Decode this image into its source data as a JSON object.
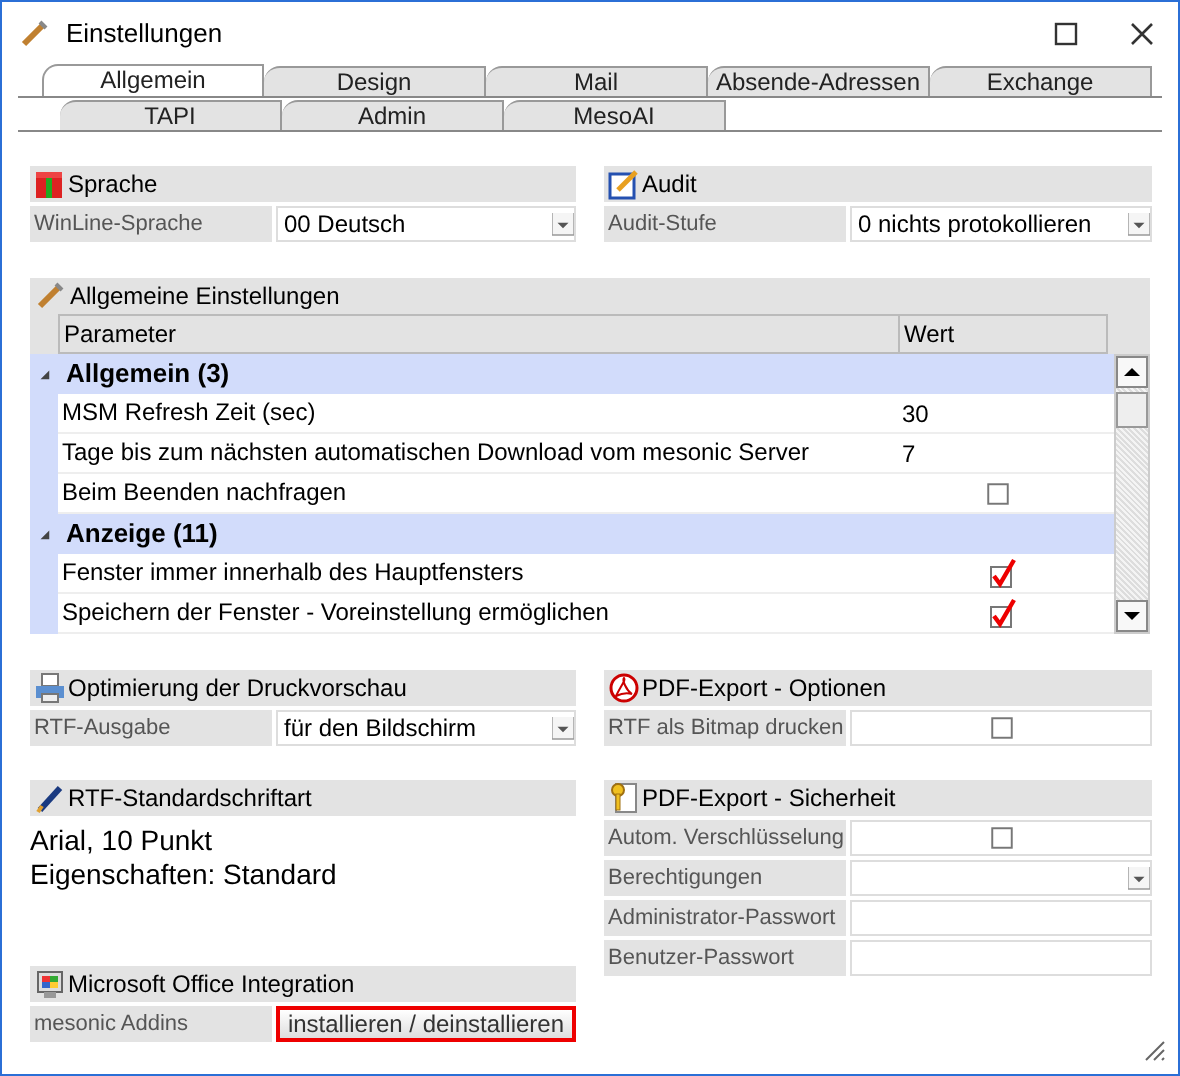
{
  "window": {
    "title": "Einstellungen"
  },
  "tab_rows": [
    [
      {
        "label": "Allgemein",
        "selected": true
      },
      {
        "label": "Design",
        "selected": false
      },
      {
        "label": "Mail",
        "selected": false
      },
      {
        "label": "Absende-Adressen",
        "selected": false
      },
      {
        "label": "Exchange",
        "selected": false
      }
    ],
    [
      {
        "label": "TAPI",
        "selected": false
      },
      {
        "label": "Admin",
        "selected": false
      },
      {
        "label": "MesoAI",
        "selected": false
      }
    ]
  ],
  "top_panels": [
    {
      "title": "Sprache",
      "rows": [
        {
          "kind": "dropdown",
          "label": "WinLine-Sprache",
          "value": "00 Deutsch"
        }
      ]
    },
    {
      "title": "Audit",
      "rows": [
        {
          "kind": "dropdown",
          "label": "Audit-Stufe",
          "value": "0 nichts protokollieren"
        }
      ]
    }
  ],
  "settings": {
    "title": "Allgemeine Einstellungen",
    "columns": [
      "Parameter",
      "Wert"
    ],
    "groups": [
      {
        "label": "Allgemein (3)",
        "expanded": true,
        "children": [
          {
            "kind": "value",
            "label": "MSM Refresh Zeit (sec)",
            "value": "30"
          },
          {
            "kind": "value",
            "label": "Tage bis zum nächsten automatischen Download vom mesonic Server",
            "value": "7"
          },
          {
            "kind": "checkbox",
            "label": "Beim Beenden nachfragen",
            "checked": false
          }
        ]
      },
      {
        "label": "Anzeige (11)",
        "expanded": true,
        "children": [
          {
            "kind": "checkbox",
            "label": "Fenster immer innerhalb des Hauptfensters",
            "checked": true
          },
          {
            "kind": "checkbox",
            "label": "Speichern der Fenster - Voreinstellung ermöglichen",
            "checked": true
          }
        ]
      }
    ]
  },
  "left_panels": [
    {
      "title": "Optimierung der Druckvorschau",
      "rows": [
        {
          "kind": "dropdown",
          "label": "RTF-Ausgabe",
          "value": "für den Bildschirm"
        }
      ]
    },
    {
      "title": "RTF-Standardschriftart",
      "lines": [
        "Arial, 10 Punkt",
        "Eigenschaften: Standard"
      ]
    },
    {
      "title": "Microsoft Office Integration",
      "rows": [
        {
          "kind": "button",
          "label": "mesonic Addins",
          "value": "installieren / deinstallieren"
        }
      ]
    }
  ],
  "right_panels": [
    {
      "title": "PDF-Export - Optionen",
      "rows": [
        {
          "kind": "checkbox",
          "label": "RTF als Bitmap drucken",
          "checked": false
        }
      ]
    },
    {
      "title": "PDF-Export - Sicherheit",
      "rows": [
        {
          "kind": "checkbox",
          "label": "Autom. Verschlüsselung",
          "checked": false
        },
        {
          "kind": "dropdown",
          "label": "Berechtigungen"
        },
        {
          "kind": "text",
          "label": "Administrator-Passwort"
        },
        {
          "kind": "text",
          "label": "Benutzer-Passwort"
        }
      ]
    }
  ]
}
